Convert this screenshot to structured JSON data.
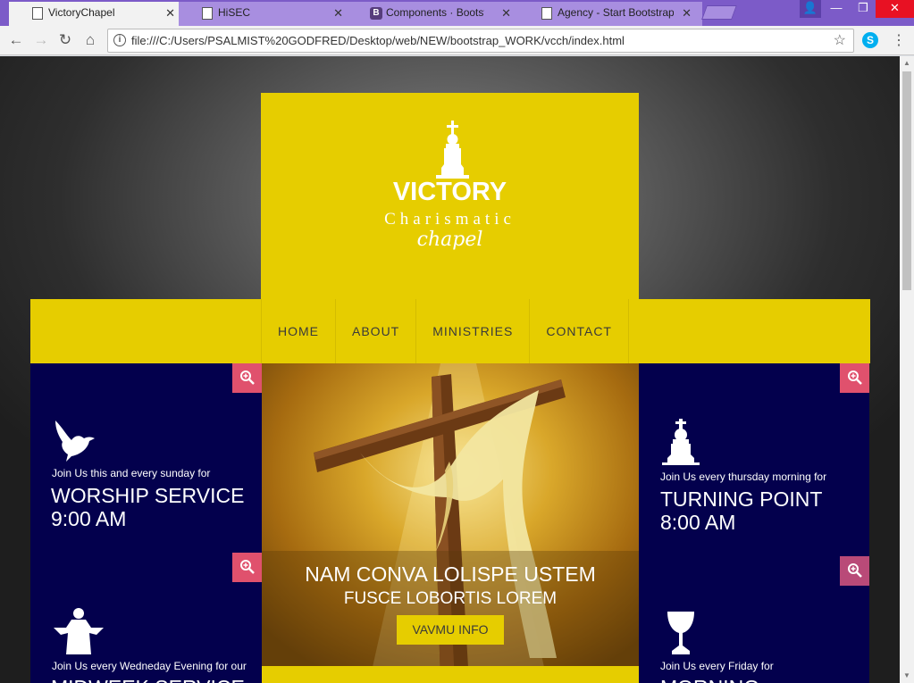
{
  "browser": {
    "tabs": [
      {
        "title": "VictoryChapel",
        "active": true
      },
      {
        "title": "HiSEC",
        "active": false
      },
      {
        "title": "Components · Bootstrap",
        "active": false
      },
      {
        "title": "Agency - Start Bootstrap",
        "active": false
      }
    ],
    "url": "file:///C:/Users/PSALMIST%20GODFRED/Desktop/web/NEW/bootstrap_WORK/vcch/index.html",
    "accent_color": "#7c5bc8"
  },
  "site": {
    "logo": {
      "line1": "VICTORY",
      "line2": "Charismatic",
      "line3": "chapel"
    },
    "nav": [
      {
        "label": "HOME"
      },
      {
        "label": "ABOUT"
      },
      {
        "label": "MINISTRIES"
      },
      {
        "label": "CONTACT"
      }
    ],
    "colors": {
      "brand_yellow": "#e6cd00",
      "panel_navy": "#03004d",
      "zoom_red": "#e0516d"
    },
    "left_panels": [
      {
        "icon": "dove-icon",
        "subtitle": "Join Us this and every sunday for",
        "title": "WORSHIP SERVICE",
        "time": "9:00 AM"
      },
      {
        "icon": "praying-figure-icon",
        "subtitle": "Join Us every Wedneday Evening for our",
        "title": "MIDWEEK SERVICE"
      }
    ],
    "right_panels": [
      {
        "icon": "church-icon",
        "subtitle": "Join Us every thursday morning for",
        "title": "TURNING POINT",
        "time": "8:00 AM"
      },
      {
        "icon": "chalice-icon",
        "subtitle": "Join Us every Friday for",
        "title": "MORNING"
      }
    ],
    "hero": {
      "heading": "NAM CONVA LOLISPE USTEM",
      "subheading": "FUSCE LOBORTIS LOREM",
      "button_label": "VAVMU INFO"
    }
  }
}
